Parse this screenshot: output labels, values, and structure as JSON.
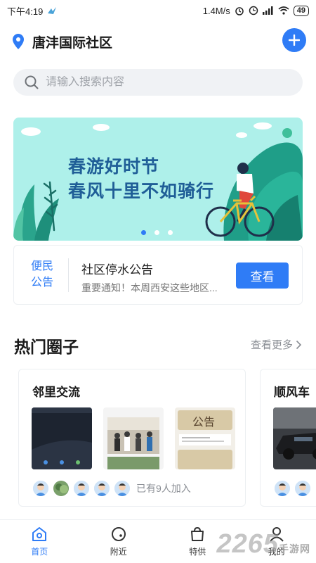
{
  "status_bar": {
    "time": "下午4:19",
    "speed": "1.4M/s",
    "battery": "49"
  },
  "header": {
    "title": "唐沣国际社区",
    "location_icon": "location-pin-icon",
    "add_icon": "plus-icon",
    "accent": "#2f7cf6"
  },
  "search": {
    "placeholder": "请输入搜索内容",
    "icon": "search-icon"
  },
  "banner": {
    "line1": "春游好时节",
    "line2": "春风十里不如骑行",
    "slide_count": 3,
    "active_slide": 1
  },
  "notice": {
    "tag": "便民公告",
    "title": "社区停水公告",
    "subtitle": "重要通知！本周西安这些地区...",
    "button": "查看"
  },
  "hot_circles": {
    "title": "热门圈子",
    "more": "查看更多",
    "cards": [
      {
        "title": "邻里交流",
        "joined": "已有9人加入"
      },
      {
        "title": "顺风车"
      }
    ]
  },
  "thumb_text": {
    "notice_stamp": "公告"
  },
  "tabbar": {
    "items": [
      {
        "label": "首页",
        "icon": "home-icon",
        "active": true
      },
      {
        "label": "附近",
        "icon": "nearby-icon",
        "active": false
      },
      {
        "label": "特供",
        "icon": "shopping-bag-icon",
        "active": false
      },
      {
        "label": "我的",
        "icon": "profile-icon",
        "active": false
      }
    ]
  },
  "watermark": {
    "brand": "2265",
    "sub": "手游网"
  }
}
